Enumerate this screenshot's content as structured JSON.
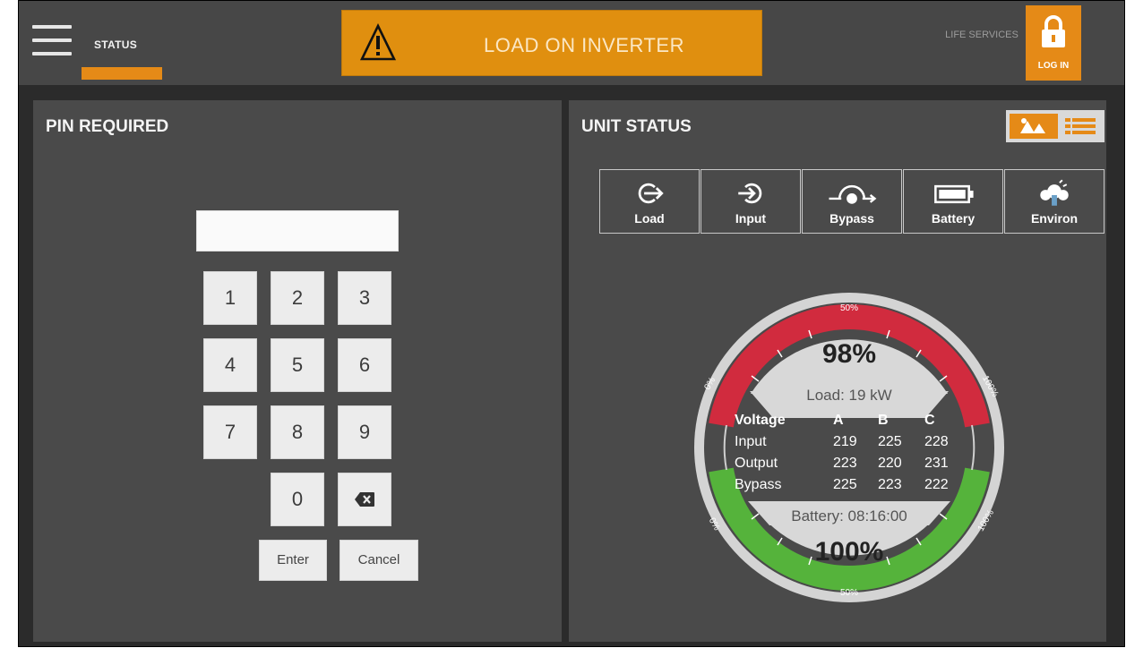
{
  "header": {
    "status_tab": "STATUS",
    "alarm_text": "LOAD ON INVERTER",
    "life_services": "LIFE SERVICES",
    "login_label": "LOG IN",
    "accent_color": "#e58a17"
  },
  "pin_panel": {
    "title": "PIN REQUIRED",
    "pin_value": "",
    "keys": [
      "1",
      "2",
      "3",
      "4",
      "5",
      "6",
      "7",
      "8",
      "9",
      "0"
    ],
    "backspace_icon": "backspace-icon",
    "enter_label": "Enter",
    "cancel_label": "Cancel"
  },
  "unit_status": {
    "title": "UNIT STATUS",
    "tabs": [
      "Load",
      "Input",
      "Bypass",
      "Battery",
      "Environ"
    ],
    "gauge": {
      "load_percent": "98%",
      "load_text": "Load: 19 kW",
      "battery_text": "Battery: 08:16:00",
      "battery_percent": "100%",
      "arc_labels": {
        "top_mid": "50%",
        "top_left": "0%",
        "top_right": "100%",
        "bottom_mid": "50%",
        "bottom_left": "0%",
        "bottom_right": "100%"
      },
      "load_level": 0.98,
      "battery_level": 1.0
    },
    "voltage_table": {
      "headers": [
        "Voltage",
        "A",
        "B",
        "C"
      ],
      "rows": [
        [
          "Input",
          "219",
          "225",
          "228"
        ],
        [
          "Output",
          "223",
          "220",
          "231"
        ],
        [
          "Bypass",
          "225",
          "223",
          "222"
        ]
      ]
    }
  }
}
